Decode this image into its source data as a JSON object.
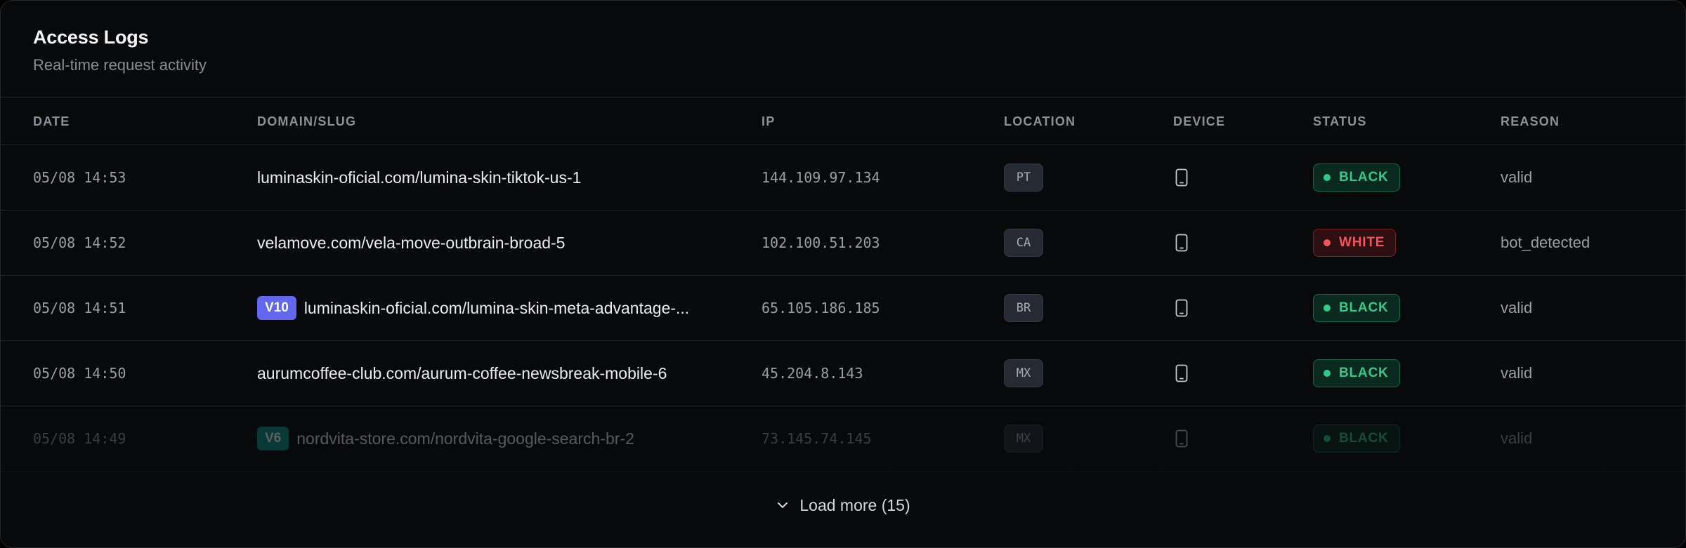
{
  "header": {
    "title": "Access Logs",
    "subtitle": "Real-time request activity"
  },
  "columns": [
    "DATE",
    "DOMAIN/SLUG",
    "IP",
    "LOCATION",
    "DEVICE",
    "STATUS",
    "REASON"
  ],
  "rows": [
    {
      "date": "05/08 14:53",
      "version": "",
      "domain": "luminaskin-oficial.com/lumina-skin-tiktok-us-1",
      "ip": "144.109.97.134",
      "location": "PT",
      "device": "mobile-icon",
      "status": "BLACK",
      "reason": "valid"
    },
    {
      "date": "05/08 14:52",
      "version": "",
      "domain": "velamove.com/vela-move-outbrain-broad-5",
      "ip": "102.100.51.203",
      "location": "CA",
      "device": "mobile-icon",
      "status": "WHITE",
      "reason": "bot_detected"
    },
    {
      "date": "05/08 14:51",
      "version": "V10",
      "domain": "luminaskin-oficial.com/lumina-skin-meta-advantage-...",
      "ip": "65.105.186.185",
      "location": "BR",
      "device": "mobile-icon",
      "status": "BLACK",
      "reason": "valid"
    },
    {
      "date": "05/08 14:50",
      "version": "",
      "domain": "aurumcoffee-club.com/aurum-coffee-newsbreak-mobile-6",
      "ip": "45.204.8.143",
      "location": "MX",
      "device": "mobile-icon",
      "status": "BLACK",
      "reason": "valid"
    },
    {
      "date": "05/08 14:49",
      "version": "V6",
      "domain": "nordvita-store.com/nordvita-google-search-br-2",
      "ip": "73.145.74.145",
      "location": "MX",
      "device": "mobile-icon",
      "status": "BLACK",
      "reason": "valid"
    }
  ],
  "version_colors": {
    "V10": "#6366f1",
    "V6": "#0d9488"
  },
  "footer": {
    "load_more_label": "Load more (15)"
  }
}
